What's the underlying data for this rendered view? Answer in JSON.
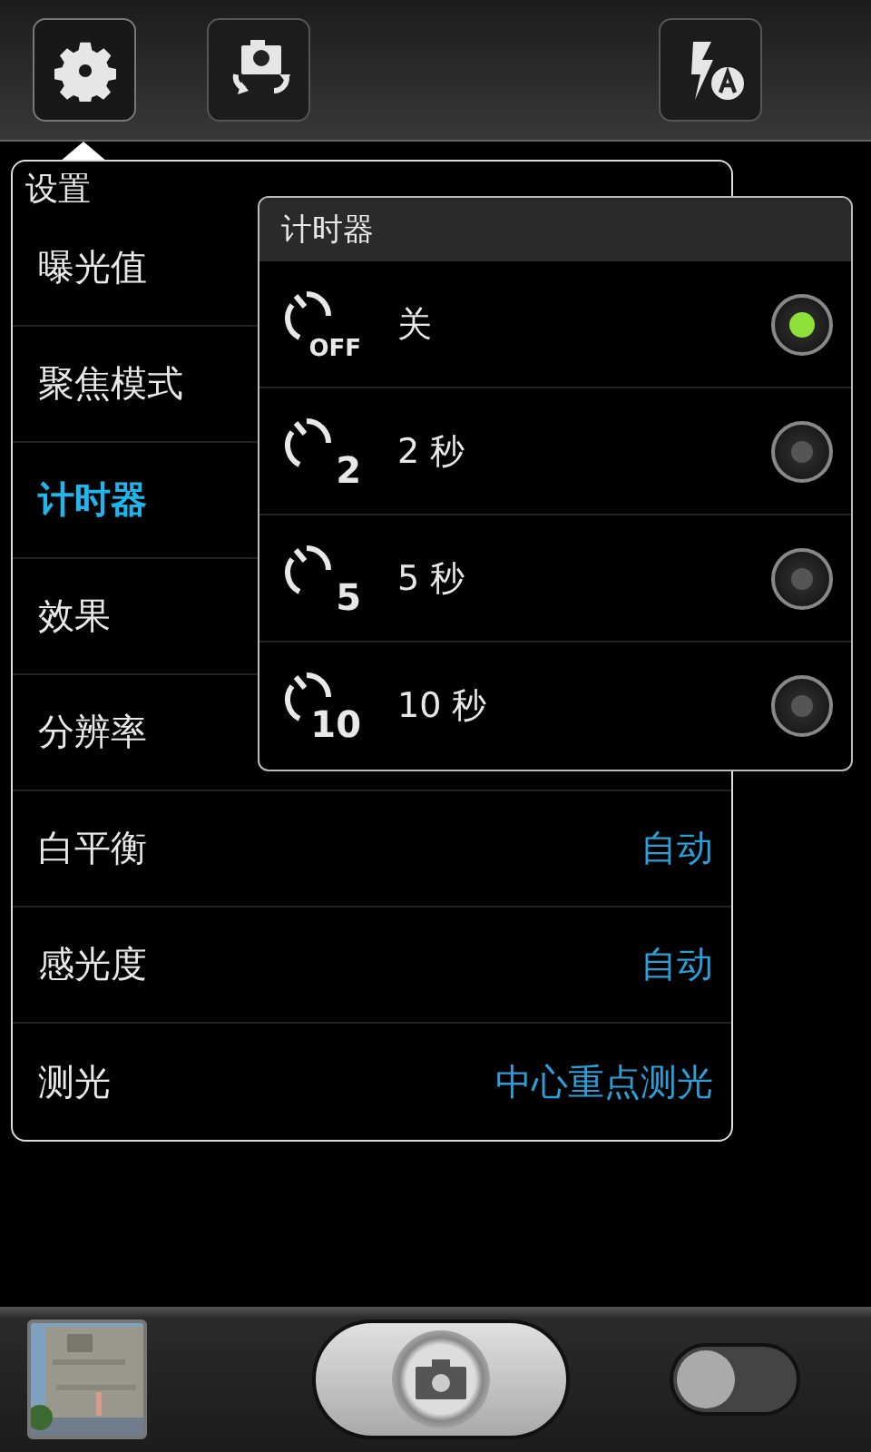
{
  "top_bar": {
    "buttons": [
      {
        "kind": "settings",
        "selected": true
      },
      {
        "kind": "switch-camera",
        "selected": false
      },
      {
        "kind": "flash-auto",
        "selected": false
      }
    ]
  },
  "settings_panel": {
    "title": "设置",
    "items": [
      {
        "label": "曝光值",
        "selected": false
      },
      {
        "label": "聚焦模式",
        "selected": false
      },
      {
        "label": "计时器",
        "selected": true
      },
      {
        "label": "效果",
        "selected": false
      },
      {
        "label": "分辨率",
        "selected": false
      },
      {
        "label": "白平衡",
        "value": "自动",
        "selected": false
      },
      {
        "label": "感光度",
        "value": "自动",
        "selected": false
      },
      {
        "label": "测光",
        "value": "中心重点测光",
        "selected": false
      }
    ]
  },
  "timer_dialog": {
    "title": "计时器",
    "options": [
      {
        "icon_text": "OFF",
        "label": "关",
        "selected": true
      },
      {
        "icon_text": "2",
        "label": "2 秒",
        "selected": false
      },
      {
        "icon_text": "5",
        "label": "5 秒",
        "selected": false
      },
      {
        "icon_text": "10",
        "label": "10 秒",
        "selected": false
      }
    ]
  },
  "bottom_bar": {
    "mode_switch": {
      "on": false
    }
  }
}
